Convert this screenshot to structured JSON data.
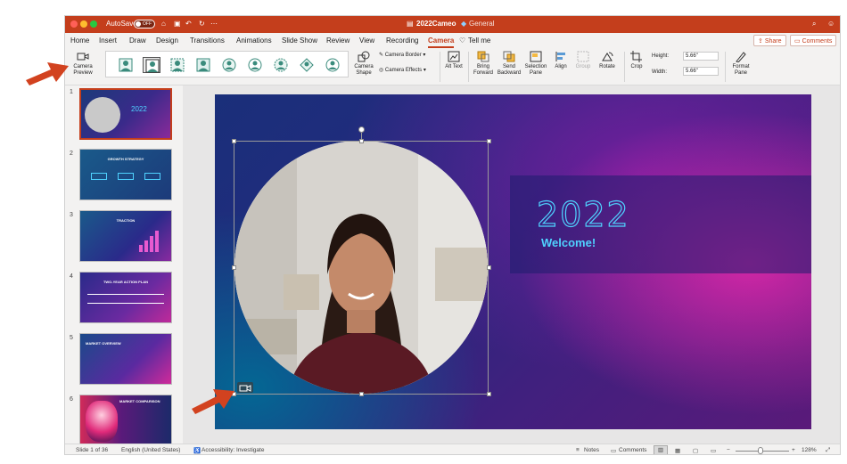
{
  "titlebar": {
    "autosave_label": "AutoSave",
    "autosave_state": "OFF",
    "document_title": "2022Cameo",
    "sensitivity_label": "General"
  },
  "menu": {
    "items": [
      "Home",
      "Insert",
      "Draw",
      "Design",
      "Transitions",
      "Animations",
      "Slide Show",
      "Review",
      "View",
      "Recording",
      "Camera"
    ],
    "tell_me": "Tell me",
    "share": "Share",
    "comments": "Comments"
  },
  "ribbon": {
    "camera_preview": "Camera Preview",
    "camera_shape": "Camera Shape",
    "camera_border": "Camera Border",
    "camera_effects": "Camera Effects",
    "alt_text": "Alt Text",
    "bring_forward": "Bring Forward",
    "send_backward": "Send Backward",
    "selection_pane": "Selection Pane",
    "align": "Align",
    "group": "Group",
    "rotate": "Rotate",
    "crop": "Crop",
    "height_label": "Height:",
    "height_value": "5.66\"",
    "width_label": "Width:",
    "width_value": "5.66\"",
    "format_pane": "Format Pane"
  },
  "thumbnails": [
    {
      "num": "1",
      "title": "2022"
    },
    {
      "num": "2",
      "title": "GROWTH STRATEGY"
    },
    {
      "num": "3",
      "title": "TRACTION"
    },
    {
      "num": "4",
      "title": "TWO-YEAR ACTION PLAN"
    },
    {
      "num": "5",
      "title": "MARKET OVERVIEW"
    },
    {
      "num": "6",
      "title": "MARKET COMPARISON"
    }
  ],
  "slide": {
    "year": "2022",
    "welcome": "Welcome!"
  },
  "status": {
    "slide_of": "Slide 1 of 36",
    "language": "English (United States)",
    "accessibility": "Accessibility: Investigate",
    "notes": "Notes",
    "comments": "Comments",
    "zoom": "128%"
  },
  "colors": {
    "accent": "#c43e1c",
    "title_cyan": "#4fd2ff",
    "annotation_arrow": "#d2421f"
  }
}
